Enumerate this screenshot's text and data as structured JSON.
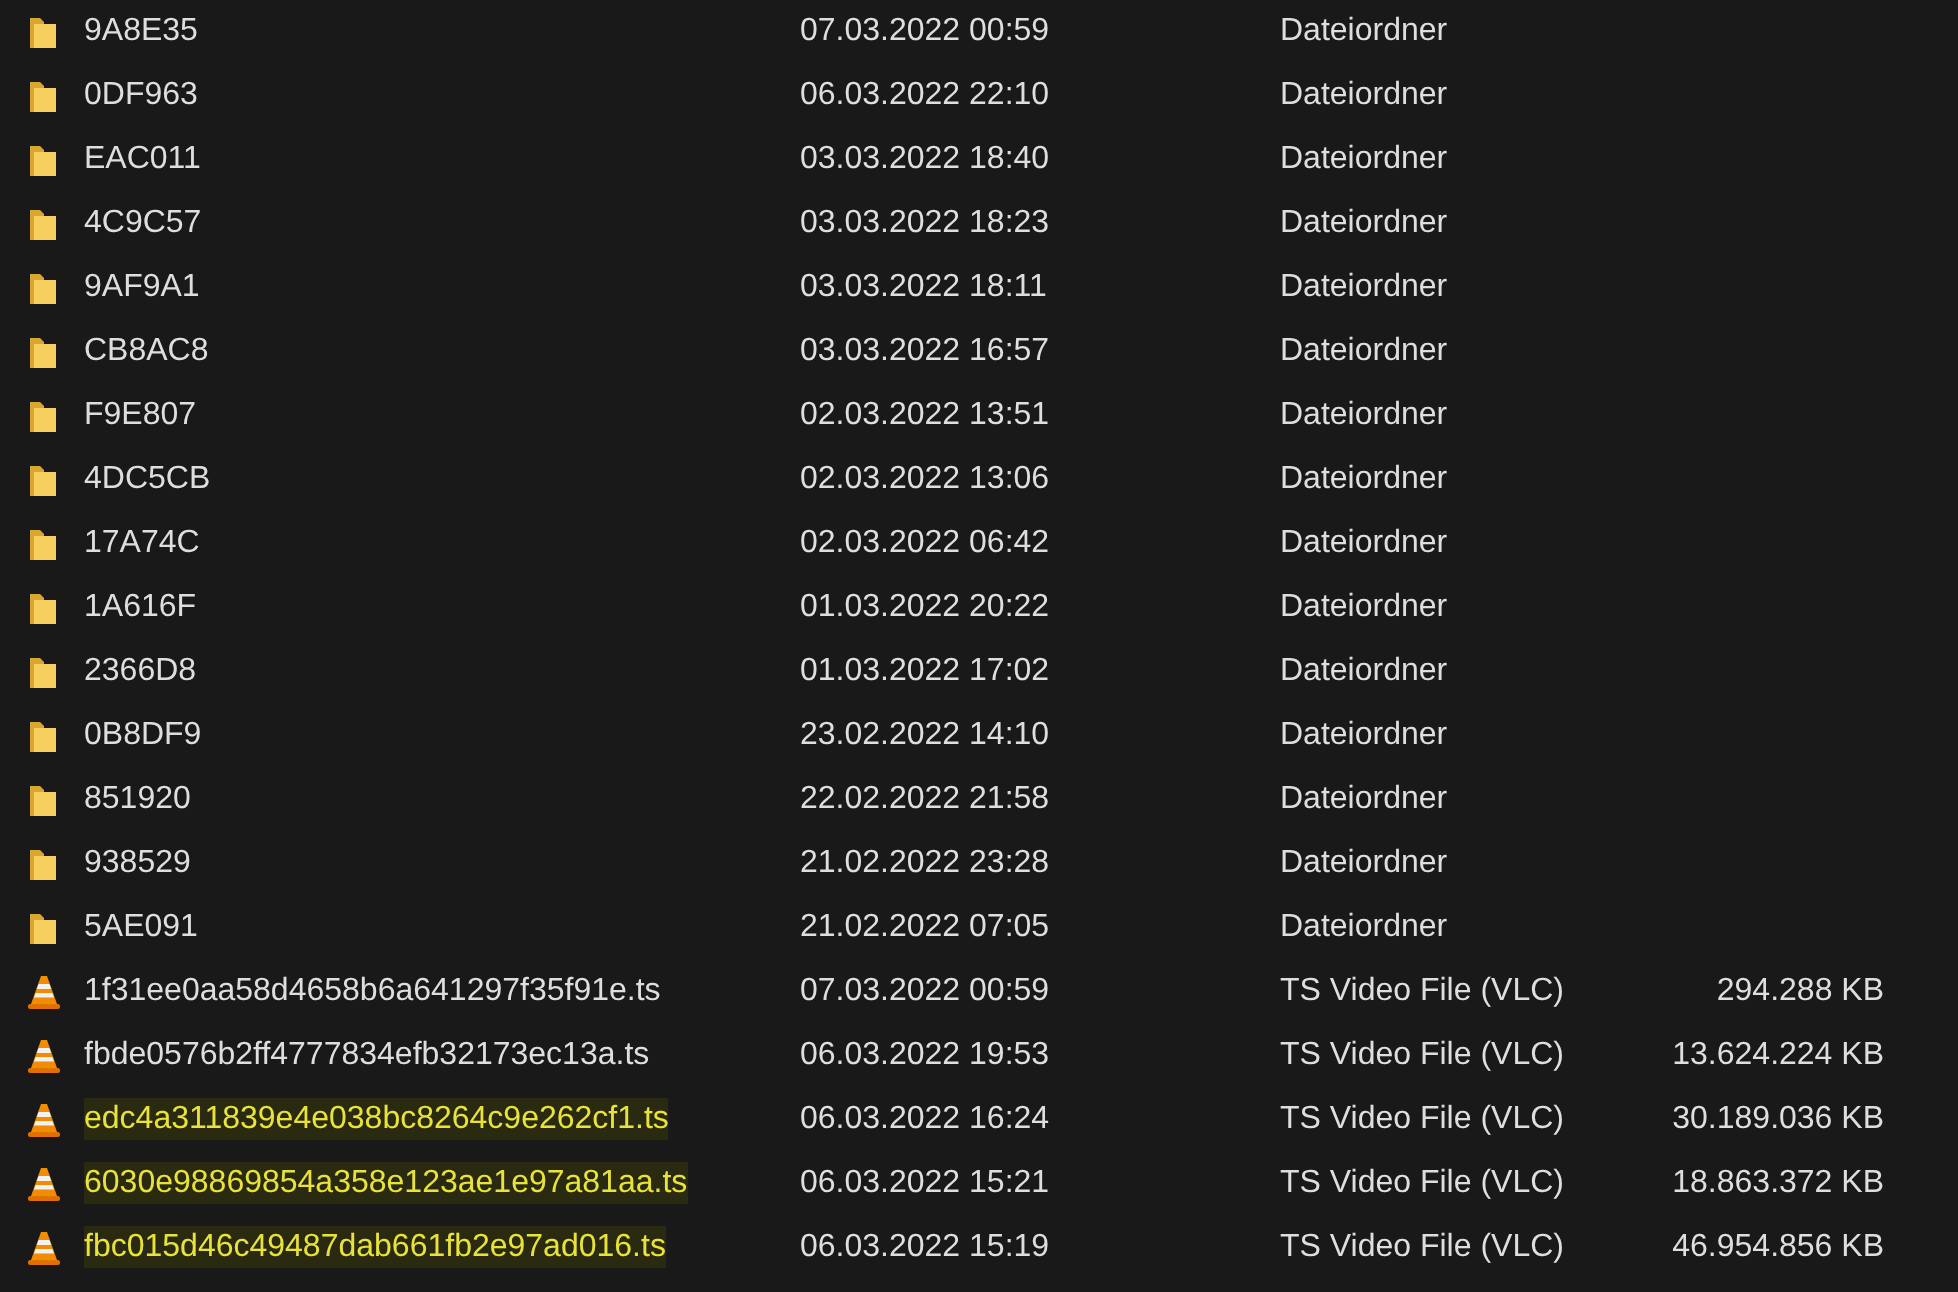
{
  "files": [
    {
      "kind": "folder",
      "name": "9A8E35",
      "date": "07.03.2022 00:59",
      "type": "Dateiordner",
      "highlighted": false
    },
    {
      "kind": "folder",
      "name": "0DF963",
      "date": "06.03.2022 22:10",
      "type": "Dateiordner",
      "highlighted": false
    },
    {
      "kind": "folder",
      "name": "EAC011",
      "date": "03.03.2022 18:40",
      "type": "Dateiordner",
      "highlighted": false
    },
    {
      "kind": "folder",
      "name": "4C9C57",
      "date": "03.03.2022 18:23",
      "type": "Dateiordner",
      "highlighted": false
    },
    {
      "kind": "folder",
      "name": "9AF9A1",
      "date": "03.03.2022 18:11",
      "type": "Dateiordner",
      "highlighted": false
    },
    {
      "kind": "folder",
      "name": "CB8AC8",
      "date": "03.03.2022 16:57",
      "type": "Dateiordner",
      "highlighted": false
    },
    {
      "kind": "folder",
      "name": "F9E807",
      "date": "02.03.2022 13:51",
      "type": "Dateiordner",
      "highlighted": false
    },
    {
      "kind": "folder",
      "name": "4DC5CB",
      "date": "02.03.2022 13:06",
      "type": "Dateiordner",
      "highlighted": false
    },
    {
      "kind": "folder",
      "name": "17A74C",
      "date": "02.03.2022 06:42",
      "type": "Dateiordner",
      "highlighted": false
    },
    {
      "kind": "folder",
      "name": "1A616F",
      "date": "01.03.2022 20:22",
      "type": "Dateiordner",
      "highlighted": false
    },
    {
      "kind": "folder",
      "name": "2366D8",
      "date": "01.03.2022 17:02",
      "type": "Dateiordner",
      "highlighted": false
    },
    {
      "kind": "folder",
      "name": "0B8DF9",
      "date": "23.02.2022 14:10",
      "type": "Dateiordner",
      "highlighted": false
    },
    {
      "kind": "folder",
      "name": "851920",
      "date": "22.02.2022 21:58",
      "type": "Dateiordner",
      "highlighted": false
    },
    {
      "kind": "folder",
      "name": "938529",
      "date": "21.02.2022 23:28",
      "type": "Dateiordner",
      "highlighted": false
    },
    {
      "kind": "folder",
      "name": "5AE091",
      "date": "21.02.2022 07:05",
      "type": "Dateiordner",
      "highlighted": false
    },
    {
      "kind": "video",
      "name": "1f31ee0aa58d4658b6a641297f35f91e.ts",
      "date": "07.03.2022 00:59",
      "type": "TS Video File (VLC)",
      "size": "294.288 KB",
      "highlighted": false
    },
    {
      "kind": "video",
      "name": "fbde0576b2ff4777834efb32173ec13a.ts",
      "date": "06.03.2022 19:53",
      "type": "TS Video File (VLC)",
      "size": "13.624.224 KB",
      "highlighted": false
    },
    {
      "kind": "video",
      "name": "edc4a311839e4e038bc8264c9e262cf1.ts",
      "date": "06.03.2022 16:24",
      "type": "TS Video File (VLC)",
      "size": "30.189.036 KB",
      "highlighted": true
    },
    {
      "kind": "video",
      "name": "6030e98869854a358e123ae1e97a81aa.ts",
      "date": "06.03.2022 15:21",
      "type": "TS Video File (VLC)",
      "size": "18.863.372 KB",
      "highlighted": true
    },
    {
      "kind": "video",
      "name": "fbc015d46c49487dab661fb2e97ad016.ts",
      "date": "06.03.2022 15:19",
      "type": "TS Video File (VLC)",
      "size": "46.954.856 KB",
      "highlighted": true
    }
  ]
}
